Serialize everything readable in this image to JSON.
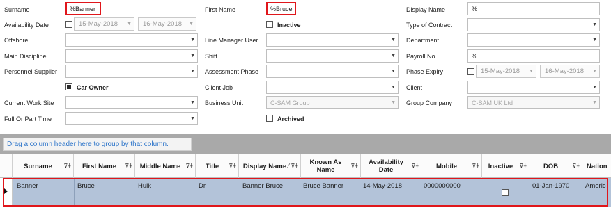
{
  "form": {
    "surname": {
      "label": "Surname",
      "value": "%Banner"
    },
    "first_name": {
      "label": "First Name",
      "value": "%Bruce"
    },
    "display_name": {
      "label": "Display Name",
      "value": "%"
    },
    "availability_date": {
      "label": "Availability Date",
      "from": "15-May-2018",
      "to": "16-May-2018"
    },
    "inactive": {
      "label": "Inactive",
      "checked": false
    },
    "type_of_contract": {
      "label": "Type of Contract",
      "value": ""
    },
    "offshore": {
      "label": "Offshore",
      "value": ""
    },
    "line_manager_user": {
      "label": "Line Manager User",
      "value": ""
    },
    "department": {
      "label": "Department",
      "value": ""
    },
    "main_discipline": {
      "label": "Main Discipline",
      "value": ""
    },
    "shift": {
      "label": "Shift",
      "value": ""
    },
    "payroll_no": {
      "label": "Payroll No",
      "value": "%"
    },
    "personnel_supplier": {
      "label": "Personnel Supplier",
      "value": ""
    },
    "assessment_phase": {
      "label": "Assessment Phase",
      "value": ""
    },
    "phase_expiry": {
      "label": "Phase Expiry",
      "from": "15-May-2018",
      "to": "16-May-2018"
    },
    "car_owner": {
      "label": "Car Owner",
      "checked": true
    },
    "client_job": {
      "label": "Client Job",
      "value": ""
    },
    "client": {
      "label": "Client",
      "value": ""
    },
    "current_work_site": {
      "label": "Current Work Site",
      "value": ""
    },
    "business_unit": {
      "label": "Business Unit",
      "value": "C-SAM Group"
    },
    "group_company": {
      "label": "Group Company",
      "value": "C-SAM UK  Ltd"
    },
    "full_or_part_time": {
      "label": "Full Or Part Time",
      "value": ""
    },
    "archived": {
      "label": "Archived",
      "checked": false
    }
  },
  "grid": {
    "group_hint": "Drag a column header here to group by that column.",
    "columns": [
      "Surname",
      "First Name",
      "Middle Name",
      "Title",
      "Display Name",
      "Known As Name",
      "Availability Date",
      "Mobile",
      "Inactive",
      "DOB",
      "Nation"
    ],
    "row": {
      "surname": "Banner",
      "first_name": "Bruce",
      "middle_name": "Hulk",
      "title": "Dr",
      "display_name": "Banner Bruce",
      "known_as_name": "Bruce Banner",
      "availability_date": "14-May-2018",
      "mobile": "0000000000",
      "inactive": false,
      "dob": "01-Jan-1970",
      "nation": "Americ"
    }
  },
  "icons": {
    "dropdown": "chevron-down-icon",
    "filter": "filter-icon",
    "pin": "pin-icon",
    "row_indicator": "current-row-arrow-icon"
  },
  "colors": {
    "highlight": "#e0161b",
    "selected_row": "#b3c3d9",
    "group_hint_text": "#2a73c9"
  }
}
